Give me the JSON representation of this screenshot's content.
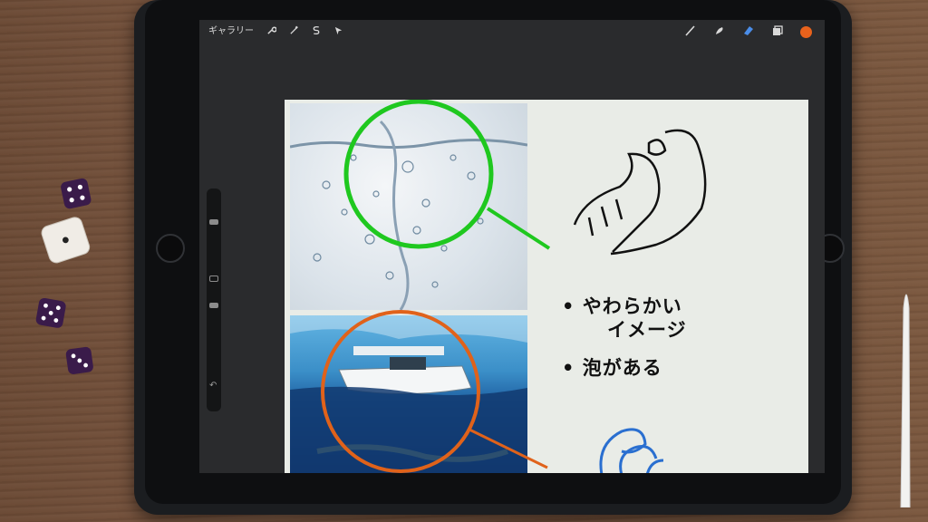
{
  "toolbar": {
    "gallery_label": "ギャラリー",
    "actions_icon": "wrench-icon",
    "adjustments_icon": "magic-wand-icon",
    "selection_icon": "selection-s-icon",
    "transform_icon": "arrow-cursor-icon",
    "brush_icon": "brush-icon",
    "smudge_icon": "smudge-icon",
    "eraser_icon": "eraser-icon",
    "layers_icon": "layers-icon",
    "active_color": "#e8621c"
  },
  "canvas": {
    "bullet_1_line_1": "• やわらかい",
    "bullet_1_line_2": "イメージ",
    "bullet_2": "• 泡がある",
    "circle_top_color": "#1fc81f",
    "circle_bottom_color": "#e0621a"
  },
  "sidebar": {
    "undo_icon": "undo-arrow-icon"
  }
}
